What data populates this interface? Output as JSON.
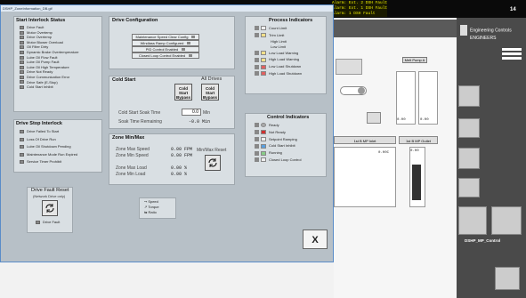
{
  "window": {
    "title": "DSHP_ZoneInformation_DB.gif"
  },
  "top_alarms": [
    "Alarm: Ext. 2 DSH Fault",
    "Alarm: Ext. 1 DSH Fault",
    "Alarm: 1 DSH Fault"
  ],
  "alarm_count": "14",
  "right_panel": {
    "engineering_controls": "Engineering Controls",
    "engineers": "ENGINEERS",
    "dshp_label": "DSHP_MP_Control"
  },
  "start_interlock": {
    "title": "Start Interlock Status",
    "items": [
      "Drive Fault",
      "Motor Overtemp",
      "Drive Overtemp",
      "Motor Blower Overload",
      "Oil Filter Dirty",
      "Dynamic Brake Overtemperature",
      "Lube Oil Flow Fault",
      "Lube Oil Pump Fault",
      "Lube Oil High Temperature",
      "Drive Not Ready",
      "Drive Communication Error",
      "Drive Safe (E-Stop)",
      "Cold Start Inhibit"
    ]
  },
  "drive_stop": {
    "title": "Drive Stop Interlock",
    "items": [
      "Drive Failed To Start",
      "Loss Of Drive Run",
      "Lube Oil Shutdown Pending",
      "Maintenance Mode Run Expired",
      "Service Timer Prohibit"
    ]
  },
  "drive_fault_reset": {
    "title": "Drive Fault Reset",
    "sub": "(Network Drive only)",
    "drive_fault": "Drive Fault"
  },
  "drive_config": {
    "title": "Drive Configuration",
    "items": [
      "Maintenance Speed Clear Config",
      "Windlass Ramp Configured",
      "PID Control Enabled",
      "Closed Loop Control Enabled"
    ]
  },
  "cold_start": {
    "title": "Cold Start",
    "all_drives": "All Drives",
    "bypass1": "Cold Start Bypass",
    "bypass2": "Cold Start Bypass",
    "soak_time_label": "Cold Start Soak Time",
    "soak_time_value": "0.0",
    "soak_time_unit": "Min",
    "remaining_label": "Soak Time Remaining",
    "remaining_value": "-0.0 Min"
  },
  "zone": {
    "title": "Zone Min/Max",
    "max_speed_label": "Zone Max Speed",
    "max_speed_value": "0.00 FPM",
    "min_speed_label": "Zone Min Speed",
    "min_speed_value": "0.00 FPM",
    "max_load_label": "Zone Max Load",
    "max_load_value": "0.00 %",
    "min_load_label": "Zone Min Load",
    "min_load_value": "0.00 %",
    "reset_label": "Min/Max Reset"
  },
  "legend": {
    "speed": "Speed",
    "torque": "Torque",
    "ratio": "Ratio"
  },
  "process_indicators": {
    "title": "Process Indicators",
    "items": [
      "Count Limit",
      "Trim Limit",
      "High Limit",
      "Low Limit",
      "Low Load Warning",
      "High Load Warning",
      "Low Load Shutdown",
      "High Load Shutdown"
    ]
  },
  "control_indicators": {
    "title": "Control Indicators",
    "items": [
      "Ready",
      "Not Ready",
      "Setpoint Ramping",
      "Cold Start Inhibit",
      "Running",
      "Closed Loop Control"
    ]
  },
  "close_button": "X",
  "background": {
    "melt_pump": "Melt Pump A",
    "inlet": "1st B MP Inlet",
    "outlet": "1st B MP Outlet",
    "readout1": "0.00",
    "readout2": "0.00",
    "readout3": "0.00",
    "readout_unit": "C",
    "trend_value": "0.00C"
  }
}
